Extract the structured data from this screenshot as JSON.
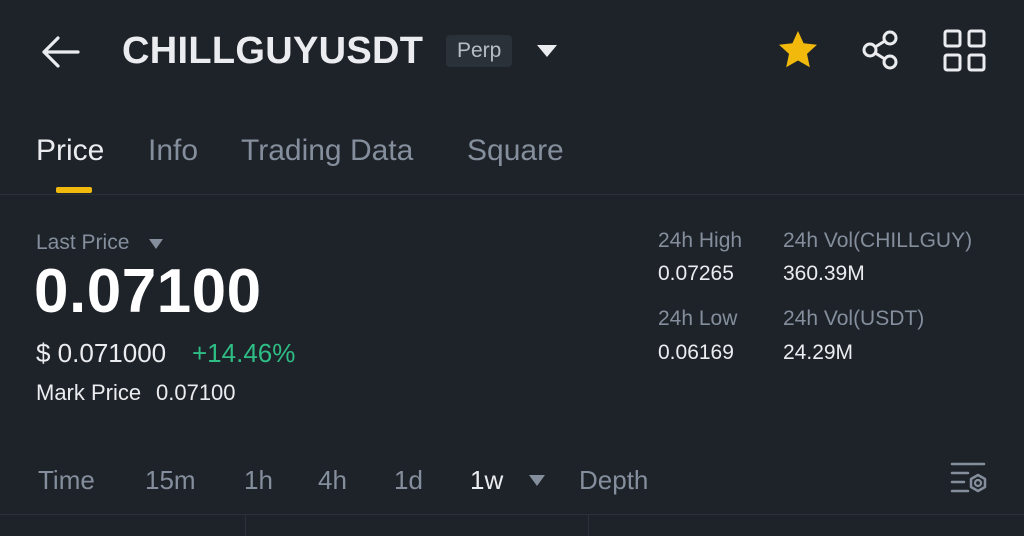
{
  "header": {
    "symbol": "CHILLGUYUSDT",
    "contract_type": "Perp",
    "icons": [
      "back-arrow-icon",
      "caret-down-icon",
      "star-icon",
      "share-icon",
      "grid-icon"
    ],
    "star_color": "#f0b90b"
  },
  "tabs": [
    {
      "label": "Price",
      "active": true
    },
    {
      "label": "Info",
      "active": false
    },
    {
      "label": "Trading Data",
      "active": false
    },
    {
      "label": "Square",
      "active": false
    }
  ],
  "price": {
    "last_price_label": "Last Price",
    "last_price": "0.07100",
    "usd_value": "$ 0.071000",
    "change": "+14.46%",
    "change_color": "#2ebd85",
    "mark_price_label": "Mark Price",
    "mark_price": "0.07100"
  },
  "stats": {
    "high_label": "24h High",
    "high": "0.07265",
    "vol_base_label": "24h Vol(CHILLGUY)",
    "vol_base": "360.39M",
    "low_label": "24h Low",
    "low": "0.06169",
    "vol_quote_label": "24h Vol(USDT)",
    "vol_quote": "24.29M"
  },
  "intervals": [
    {
      "label": "Time",
      "active": false
    },
    {
      "label": "15m",
      "active": false
    },
    {
      "label": "1h",
      "active": false
    },
    {
      "label": "4h",
      "active": false
    },
    {
      "label": "1d",
      "active": false
    },
    {
      "label": "1w",
      "active": true
    },
    {
      "label": "Depth",
      "active": false
    }
  ],
  "colors": {
    "background": "#1e2329",
    "accent": "#f0b90b",
    "muted_text": "#848e9c"
  }
}
